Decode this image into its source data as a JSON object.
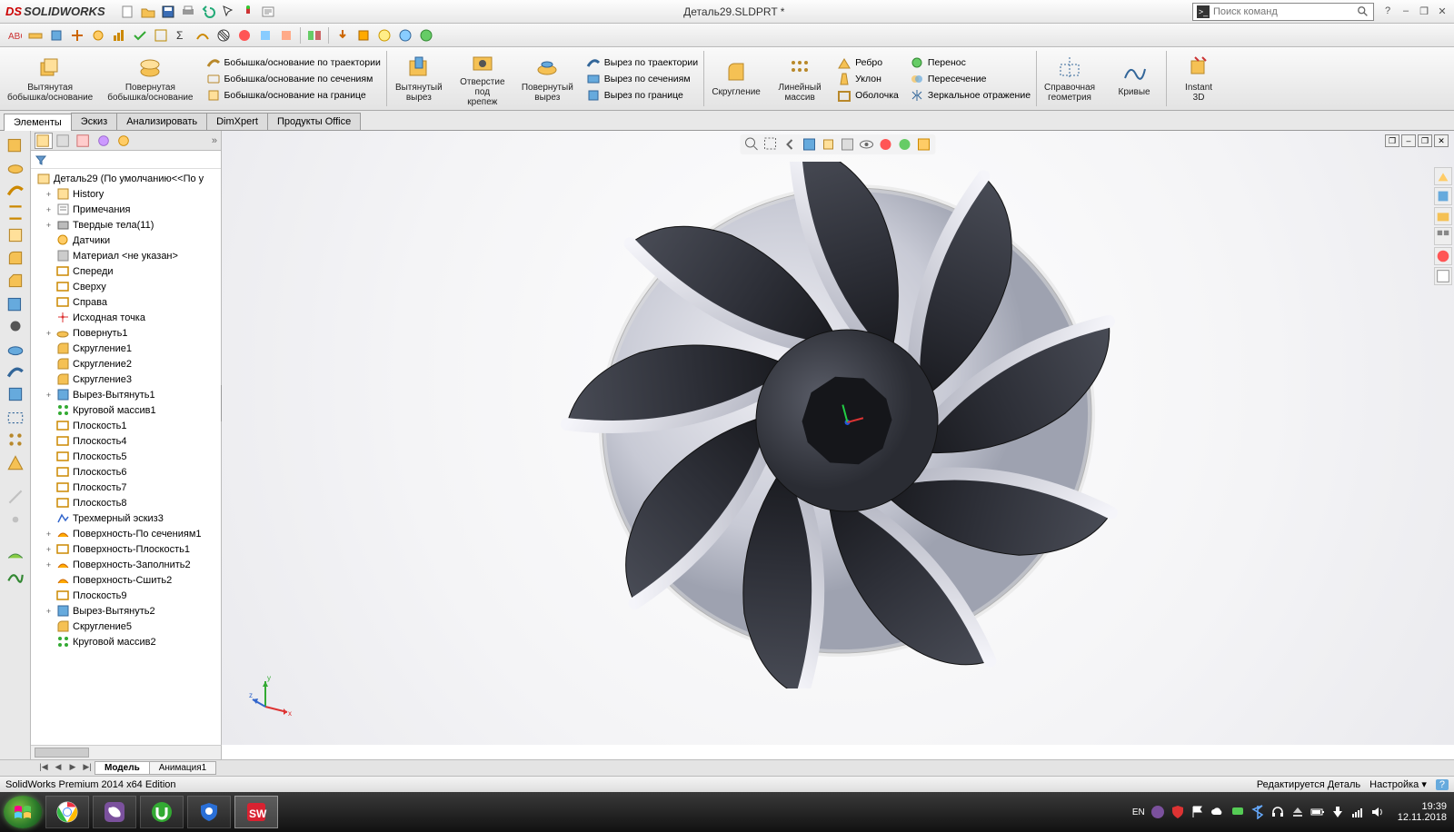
{
  "app": {
    "brand": "SOLIDWORKS",
    "document": "Деталь29.SLDPRT *"
  },
  "search": {
    "placeholder": "Поиск команд"
  },
  "ribbon": {
    "big1": "Вытянутая\nбобышка/основание",
    "big2": "Повернутая\nбобышка/основание",
    "stackA": [
      "Бобышка/основание по траектории",
      "Бобышка/основание по сечениям",
      "Бобышка/основание на границе"
    ],
    "big3": "Вытянутый\nвырез",
    "big4": "Отверстие\nпод\nкрепеж",
    "big5": "Повернутый\nвырез",
    "stackB": [
      "Вырез по траектории",
      "Вырез по сечениям",
      "Вырез по границе"
    ],
    "big6": "Скругление",
    "big7": "Линейный\nмассив",
    "stackC": [
      "Ребро",
      "Уклон",
      "Оболочка"
    ],
    "stackD": [
      "Перенос",
      "Пересечение",
      "Зеркальное отражение"
    ],
    "big8": "Справочная\nгеометрия",
    "big9": "Кривые",
    "big10": "Instant\n3D"
  },
  "tabs": [
    "Элементы",
    "Эскиз",
    "Анализировать",
    "DimXpert",
    "Продукты Office"
  ],
  "tree": {
    "root": "Деталь29  (По умолчанию<<По у",
    "items": [
      {
        "l": "History",
        "lvl": 1,
        "exp": "+"
      },
      {
        "l": "Примечания",
        "lvl": 1,
        "exp": "+"
      },
      {
        "l": "Твердые тела(11)",
        "lvl": 1,
        "exp": "+"
      },
      {
        "l": "Датчики",
        "lvl": 1
      },
      {
        "l": "Материал <не указан>",
        "lvl": 1
      },
      {
        "l": "Спереди",
        "lvl": 1
      },
      {
        "l": "Сверху",
        "lvl": 1
      },
      {
        "l": "Справа",
        "lvl": 1
      },
      {
        "l": "Исходная точка",
        "lvl": 1
      },
      {
        "l": "Повернуть1",
        "lvl": 1,
        "exp": "+"
      },
      {
        "l": "Скругление1",
        "lvl": 1
      },
      {
        "l": "Скругление2",
        "lvl": 1
      },
      {
        "l": "Скругление3",
        "lvl": 1
      },
      {
        "l": "Вырез-Вытянуть1",
        "lvl": 1,
        "exp": "+"
      },
      {
        "l": "Круговой массив1",
        "lvl": 1
      },
      {
        "l": "Плоскость1",
        "lvl": 1
      },
      {
        "l": "Плоскость4",
        "lvl": 1
      },
      {
        "l": "Плоскость5",
        "lvl": 1
      },
      {
        "l": "Плоскость6",
        "lvl": 1
      },
      {
        "l": "Плоскость7",
        "lvl": 1
      },
      {
        "l": "Плоскость8",
        "lvl": 1
      },
      {
        "l": "Трехмерный эскиз3",
        "lvl": 1
      },
      {
        "l": "Поверхность-По сечениям1",
        "lvl": 1,
        "exp": "+"
      },
      {
        "l": "Поверхность-Плоскость1",
        "lvl": 1,
        "exp": "+"
      },
      {
        "l": "Поверхность-Заполнить2",
        "lvl": 1,
        "exp": "+"
      },
      {
        "l": "Поверхность-Сшить2",
        "lvl": 1
      },
      {
        "l": "Плоскость9",
        "lvl": 1
      },
      {
        "l": "Вырез-Вытянуть2",
        "lvl": 1,
        "exp": "+"
      },
      {
        "l": "Скругление5",
        "lvl": 1
      },
      {
        "l": "Круговой массив2",
        "lvl": 1
      }
    ]
  },
  "bottomtabs": [
    "Модель",
    "Анимация1"
  ],
  "status": {
    "left": "SolidWorks Premium 2014 x64 Edition",
    "edit": "Редактируется Деталь",
    "set": "Настройка"
  },
  "taskbar": {
    "lang": "EN",
    "time": "19:39",
    "date": "12.11.2018"
  },
  "triad": {
    "x": "x",
    "y": "y",
    "z": "z"
  }
}
